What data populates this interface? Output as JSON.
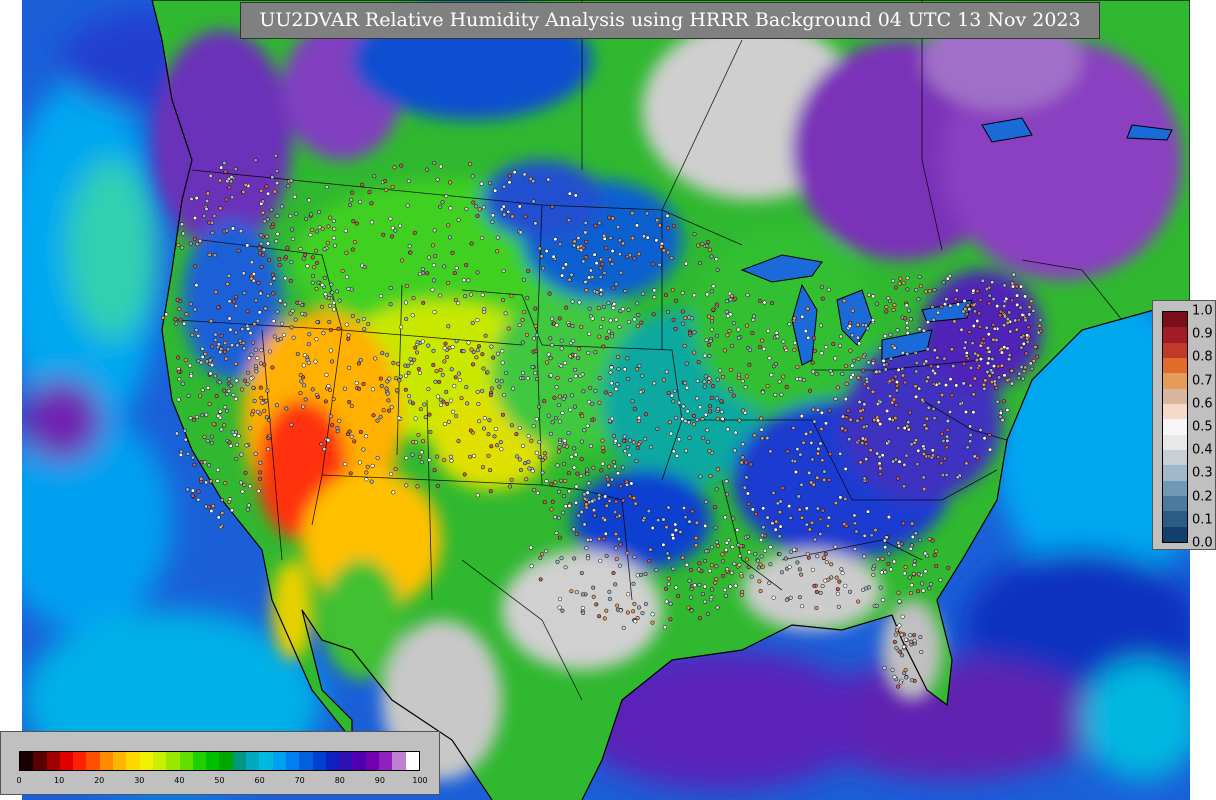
{
  "title": "UU2DVAR Relative Humidity Analysis using HRRR Background 04 UTC 13 Nov 2023",
  "rh_colorbar": {
    "ticks": [
      "0",
      "10",
      "20",
      "30",
      "40",
      "50",
      "60",
      "70",
      "80",
      "90",
      "100"
    ],
    "colors": [
      "#1a0000",
      "#5a0000",
      "#a00000",
      "#e00000",
      "#ff2000",
      "#ff5000",
      "#ff8c00",
      "#ffb400",
      "#ffd800",
      "#f0f000",
      "#c8f000",
      "#98e800",
      "#60e000",
      "#20d000",
      "#00c000",
      "#00a800",
      "#009880",
      "#00a8c0",
      "#00b8e0",
      "#00a0f0",
      "#0080f0",
      "#0060e0",
      "#0040d0",
      "#1020c0",
      "#3010b0",
      "#5000b0",
      "#7000b0",
      "#9020c0",
      "#c080d0",
      "#ffffff"
    ]
  },
  "increment_colorbar": {
    "ticks": [
      "1.0",
      "0.9",
      "0.8",
      "0.7",
      "0.6",
      "0.5",
      "0.4",
      "0.3",
      "0.2",
      "0.1",
      "0.0"
    ],
    "colors": [
      "#7a0f1a",
      "#a11c24",
      "#c0392b",
      "#e06c2a",
      "#e59b5a",
      "#d9b69c",
      "#f5d9c9",
      "#f6f6f6",
      "#e8e8e8",
      "#c9cfd6",
      "#9fb8cc",
      "#7099b5",
      "#4a7a9e",
      "#2b5c85",
      "#12406a"
    ]
  },
  "map_colors": {
    "ocean_deep": "#1750d0",
    "ocean_mid": "#00a0f0",
    "ocean_light": "#28d8d0",
    "moist": "#6020b0",
    "saturated": "#c8c8c8",
    "dry_green": "#30c020",
    "very_dry_yellow": "#e8e800",
    "extreme_dry": "#ff2000"
  }
}
